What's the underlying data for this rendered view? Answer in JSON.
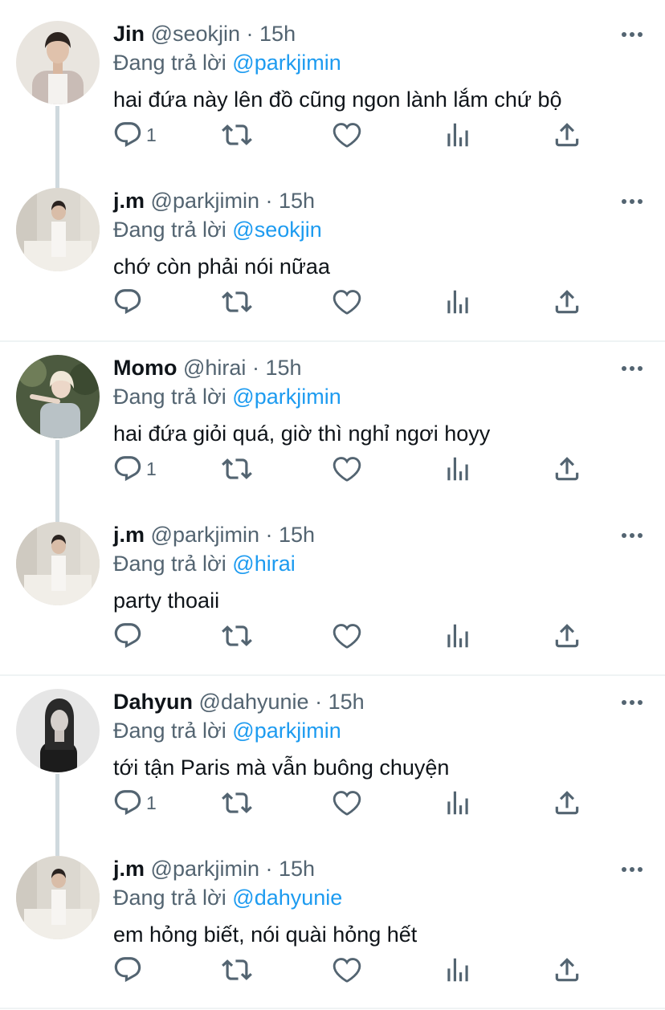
{
  "reply_prefix": "Đang trả lời",
  "dot": "·",
  "icons": {
    "more": "more-horizontal-icon",
    "reply": "reply-icon",
    "retweet": "retweet-icon",
    "like": "like-icon",
    "views": "analytics-icon",
    "share": "share-icon"
  },
  "colors": {
    "link": "#1d9bf0",
    "muted": "#536471",
    "text": "#0f1419",
    "thread": "#cfd9de"
  },
  "tweets": [
    {
      "name": "Jin",
      "handle": "@seokjin",
      "time": "15h",
      "reply_to": "@parkjimin",
      "text": "hai đứa này lên đồ cũng ngon lành lắm chứ bộ",
      "reply_count": "1"
    },
    {
      "name": "j.m",
      "handle": "@parkjimin",
      "time": "15h",
      "reply_to": "@seokjin",
      "text": "chớ còn phải nói nữaa",
      "reply_count": ""
    },
    {
      "name": "Momo",
      "handle": "@hirai",
      "time": "15h",
      "reply_to": "@parkjimin",
      "text": "hai đứa giỏi quá, giờ thì nghỉ ngơi hoyy",
      "reply_count": "1"
    },
    {
      "name": "j.m",
      "handle": "@parkjimin",
      "time": "15h",
      "reply_to": "@hirai",
      "text": "party thoaii",
      "reply_count": ""
    },
    {
      "name": "Dahyun",
      "handle": "@dahyunie",
      "time": "15h",
      "reply_to": "@parkjimin",
      "text": "tới tận Paris mà vẫn buông chuyện",
      "reply_count": "1"
    },
    {
      "name": "j.m",
      "handle": "@parkjimin",
      "time": "15h",
      "reply_to": "@dahyunie",
      "text": "em hỏng biết, nói quài hỏng hết",
      "reply_count": ""
    }
  ]
}
